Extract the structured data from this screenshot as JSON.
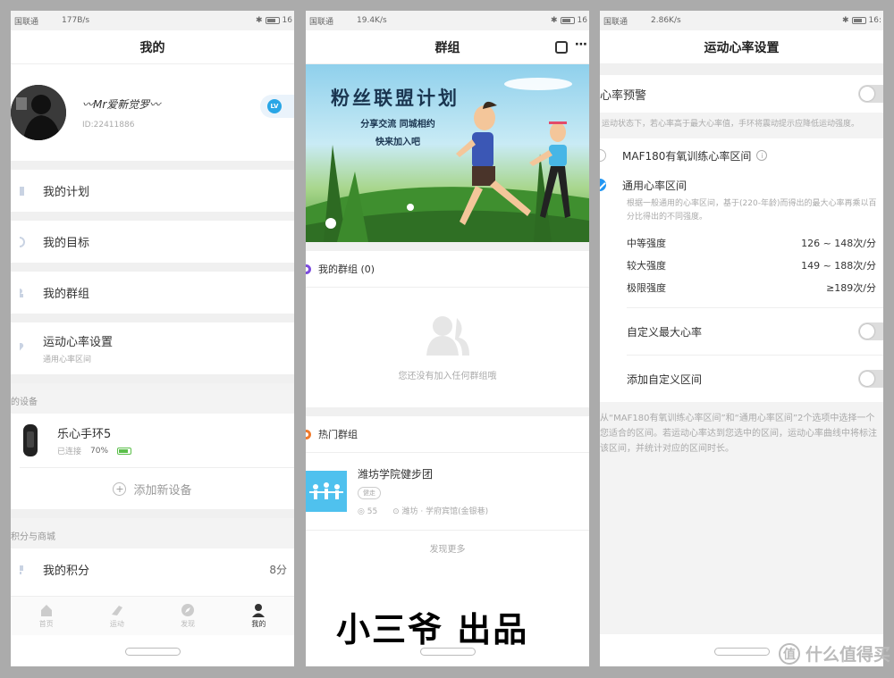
{
  "status_p1": {
    "carrier": "国联通",
    "speed": "177B/s",
    "time": "16"
  },
  "status_p2": {
    "carrier": "国联通",
    "speed": "19.4K/s",
    "time": "16"
  },
  "status_p3": {
    "carrier": "国联通",
    "speed": "2.86K/s",
    "time": "16:"
  },
  "p1": {
    "title": "我的",
    "username": "〰Mr爱新觉罗〰",
    "user_id": "ID:22411886",
    "level_badge": "LV",
    "menu": [
      {
        "label": "我的计划",
        "sub": ""
      },
      {
        "label": "我的目标",
        "sub": ""
      },
      {
        "label": "我的群组",
        "sub": ""
      },
      {
        "label": "运动心率设置",
        "sub": "通用心率区间"
      }
    ],
    "devices_section": "的设备",
    "device": {
      "name": "乐心手环5",
      "status": "已连接",
      "battery": "70%"
    },
    "add_device": "添加新设备",
    "points_section": "积分与商城",
    "points": {
      "label": "我的积分",
      "value": "8分"
    },
    "tabs": [
      {
        "label": "首页",
        "icon": "home-icon"
      },
      {
        "label": "运动",
        "icon": "shoe-icon"
      },
      {
        "label": "发现",
        "icon": "compass-icon"
      },
      {
        "label": "我的",
        "icon": "person-icon"
      }
    ]
  },
  "p2": {
    "title": "群组",
    "banner": {
      "headline": "粉丝联盟计划",
      "line1": "分享交流 同城相约",
      "line2": "快来加入吧"
    },
    "my_groups": "我的群组 (0)",
    "empty_text": "您还没有加入任何群组哦",
    "hot_groups": "热门群组",
    "group": {
      "name": "潍坊学院健步团",
      "tag": "健走",
      "members": "55",
      "location": "潍坊 · 学府宾馆(金银巷)"
    },
    "more": "发现更多",
    "watermark": "小三爷  出品"
  },
  "p3": {
    "title": "运动心率设置",
    "alert_label": "心率预警",
    "alert_desc": "运动状态下，若心率高于最大心率值，手环将震动提示应降低运动强度。",
    "option_maf": "MAF180有氧训练心率区间",
    "option_general": "通用心率区间",
    "general_desc": "根据一般通用的心率区间，基于(220-年龄)而得出的最大心率再乘以百分比得出的不同强度。",
    "zones": [
      {
        "label": "中等强度",
        "value": "126 ~ 148次/分"
      },
      {
        "label": "较大强度",
        "value": "149 ~ 188次/分"
      },
      {
        "label": "极限强度",
        "value": "≥189次/分"
      }
    ],
    "custom_max": "自定义最大心率",
    "add_custom": "添加自定义区间",
    "footnote": "从“MAF180有氧训练心率区间”和“通用心率区间”2个选项中选择一个您适合的区间。若运动心率达到您选中的区间，运动心率曲线中将标注该区间，并统计对应的区间时长。",
    "site_watermark": "什么值得买"
  }
}
